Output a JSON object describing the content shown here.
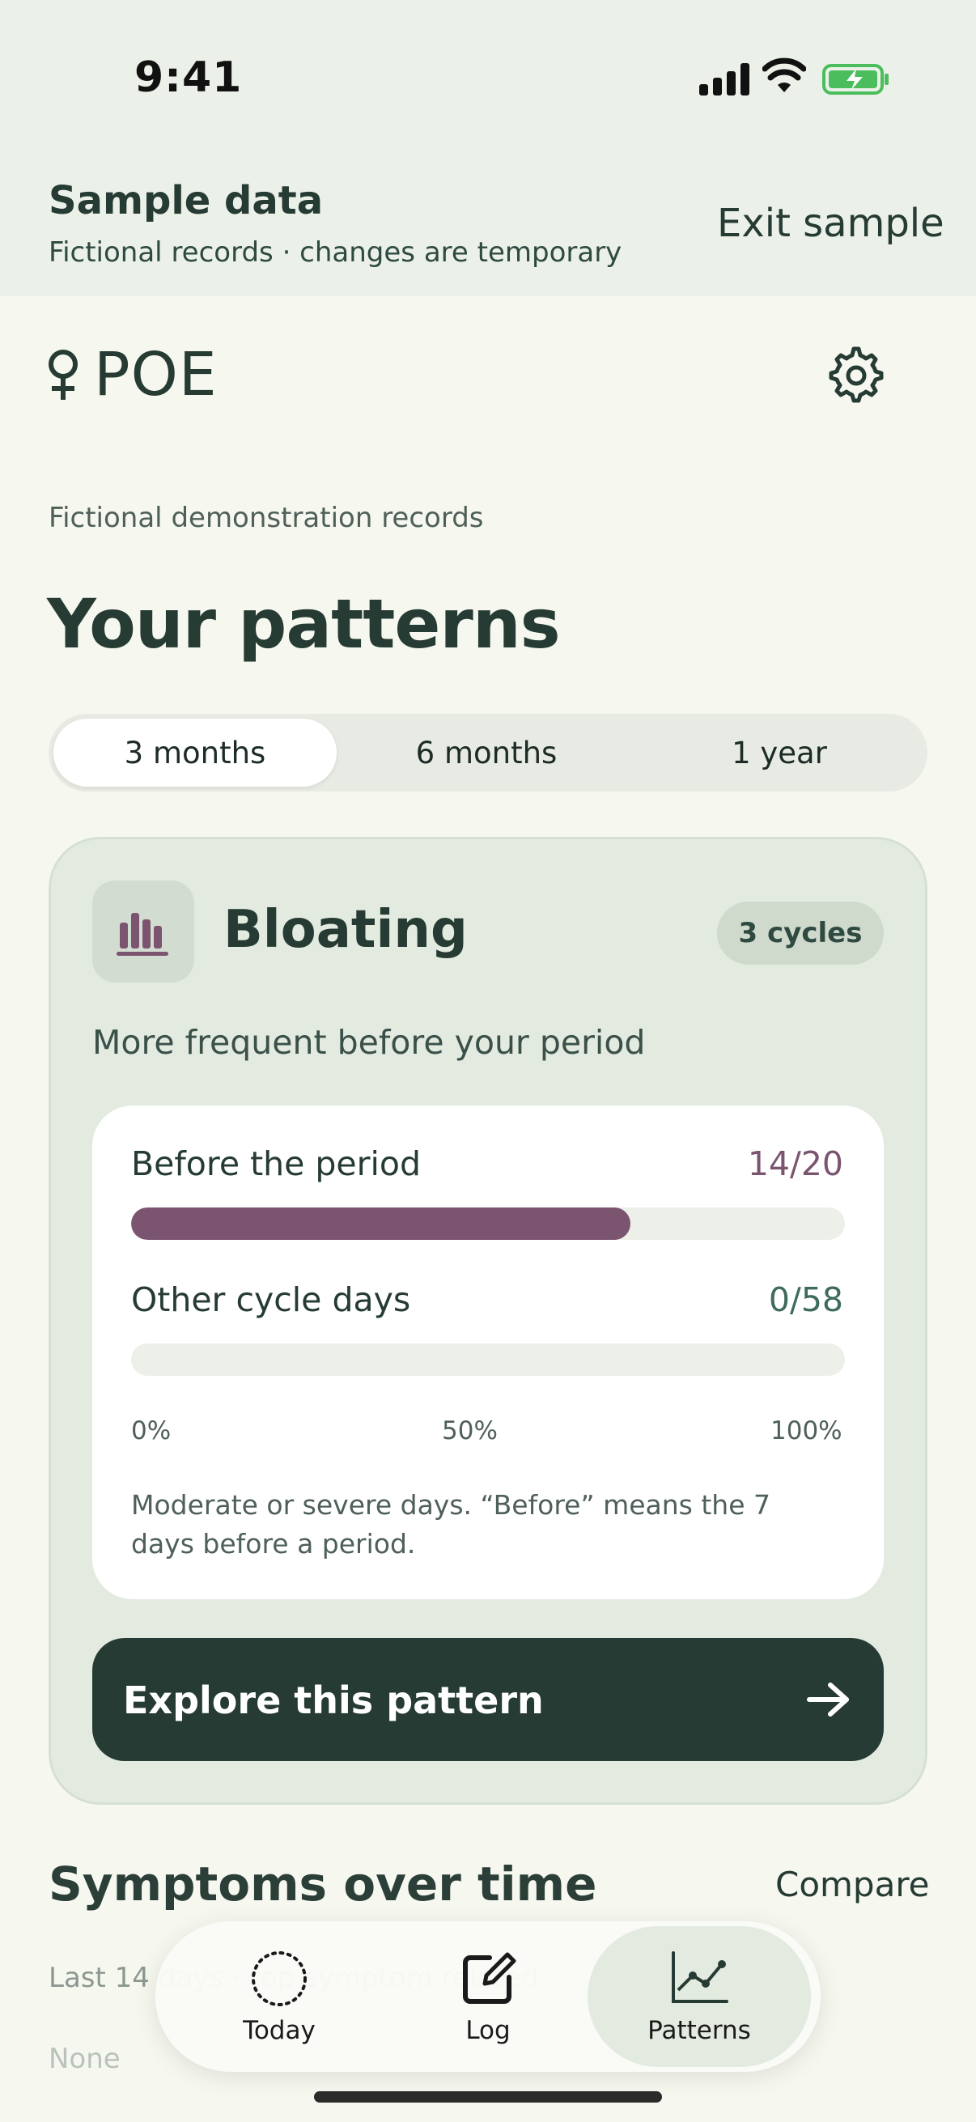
{
  "status_bar": {
    "time": "9:41"
  },
  "sample_banner": {
    "title": "Sample data",
    "subtitle": "Fictional records · changes are temporary",
    "exit_label": "Exit sample"
  },
  "header": {
    "logo_text": "POE",
    "settings_icon": "gear-icon"
  },
  "demo_label": "Fictional demonstration records",
  "page_title": "Your patterns",
  "range_tabs": {
    "options": [
      "3 months",
      "6 months",
      "1 year"
    ],
    "selected": "3 months"
  },
  "pattern_card": {
    "icon": "bar-chart-icon",
    "title": "Bloating",
    "badge": "3 cycles",
    "subtitle": "More frequent before your period",
    "rows": [
      {
        "label": "Before the period",
        "value": "14/20",
        "fraction": 0.7,
        "color": "#7b5470"
      },
      {
        "label": "Other cycle days",
        "value": "0/58",
        "fraction": 0.0,
        "color": "#3f6a5e"
      }
    ],
    "scale": [
      "0%",
      "50%",
      "100%"
    ],
    "footnote": "Moderate or severe days. “Before” means the 7 days before a period.",
    "explore_label": "Explore this pattern"
  },
  "symptoms_section": {
    "title": "Symptoms over time",
    "compare_label": "Compare",
    "subtitle": "Last 14 days · top symptom related",
    "legend_first": "None"
  },
  "tab_bar": {
    "tabs": [
      {
        "label": "Today",
        "icon": "today-circle-icon"
      },
      {
        "label": "Log",
        "icon": "log-edit-icon"
      },
      {
        "label": "Patterns",
        "icon": "patterns-chart-icon"
      }
    ],
    "active": "Patterns"
  },
  "colors": {
    "accent": "#263b33",
    "bar_before": "#7b5470",
    "value_other": "#3f6a5e",
    "card_bg": "#e3ebe1"
  }
}
